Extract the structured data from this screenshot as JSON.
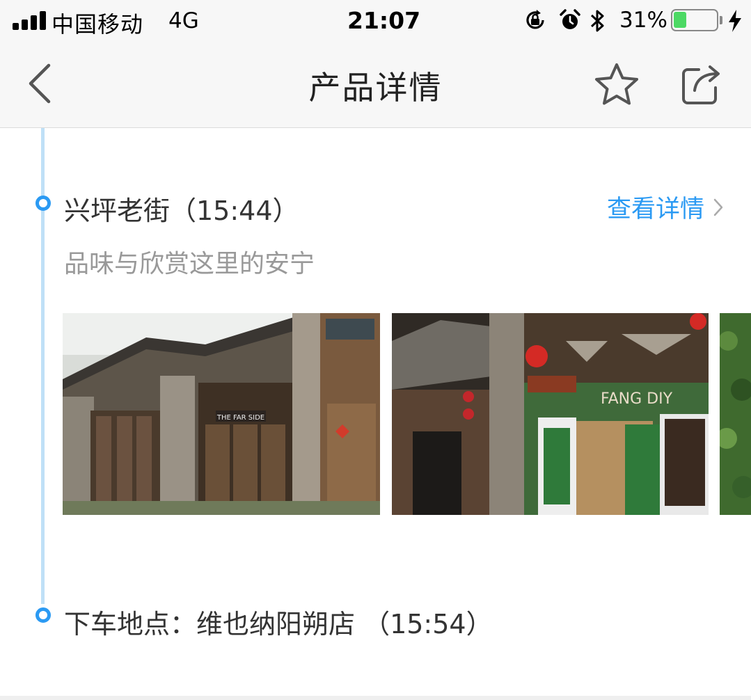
{
  "status_bar": {
    "carrier": "中国移动",
    "network": "4G",
    "time": "21:07",
    "battery_percent": "31%",
    "battery_level": 0.31,
    "icons": [
      "signal-icon",
      "orientation-lock-icon",
      "alarm-icon",
      "bluetooth-icon",
      "battery-icon",
      "charging-icon"
    ]
  },
  "nav": {
    "title": "产品详情",
    "back_icon": "chevron-left-icon",
    "favorite_icon": "star-icon",
    "share_icon": "share-icon"
  },
  "colors": {
    "accent": "#2b9af3",
    "timeline": "#bfe0f7",
    "battery": "#4cd964"
  },
  "itinerary": {
    "stops": [
      {
        "title": "兴坪老街（15:44）",
        "description": "品味与欣赏这里的安宁",
        "link_label": "查看详情",
        "photos": [
          "old-street-wooden-doors-photo",
          "old-street-shopfront-photo",
          "old-street-greenery-photo"
        ]
      },
      {
        "title": "下车地点：维也纳阳朔店 （15:54）"
      }
    ]
  }
}
